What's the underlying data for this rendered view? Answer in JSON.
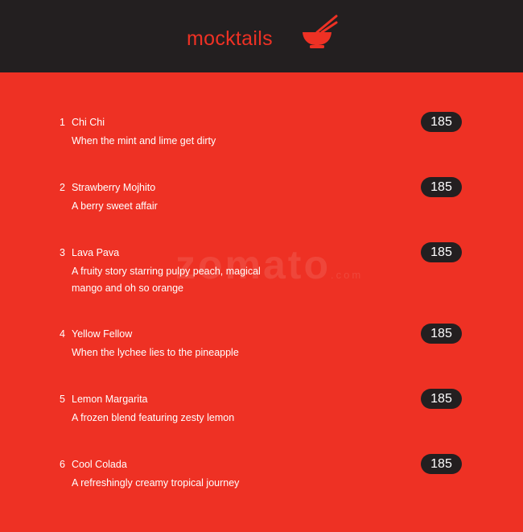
{
  "header": {
    "title": "mocktails",
    "icon": "bowl-chopsticks-icon"
  },
  "watermark": {
    "text": "zomato",
    "suffix": ".com"
  },
  "colors": {
    "background": "#ee3124",
    "header": "#231f20",
    "accent": "#ee3124"
  },
  "items": [
    {
      "num": "1",
      "name": "Chi Chi",
      "desc": "When the mint and lime get dirty",
      "price": "185"
    },
    {
      "num": "2",
      "name": "Strawberry Mojhito",
      "desc": "A berry sweet affair",
      "price": "185"
    },
    {
      "num": "3",
      "name": "Lava Pava",
      "desc": "A fruity story starring pulpy peach, magical mango and oh so orange",
      "price": "185"
    },
    {
      "num": "4",
      "name": "Yellow Fellow",
      "desc": "When the lychee lies to the pineapple",
      "price": "185"
    },
    {
      "num": "5",
      "name": "Lemon Margarita",
      "desc": "A frozen blend featuring zesty lemon",
      "price": "185"
    },
    {
      "num": "6",
      "name": "Cool Colada",
      "desc": "A refreshingly creamy tropical journey",
      "price": "185"
    }
  ]
}
